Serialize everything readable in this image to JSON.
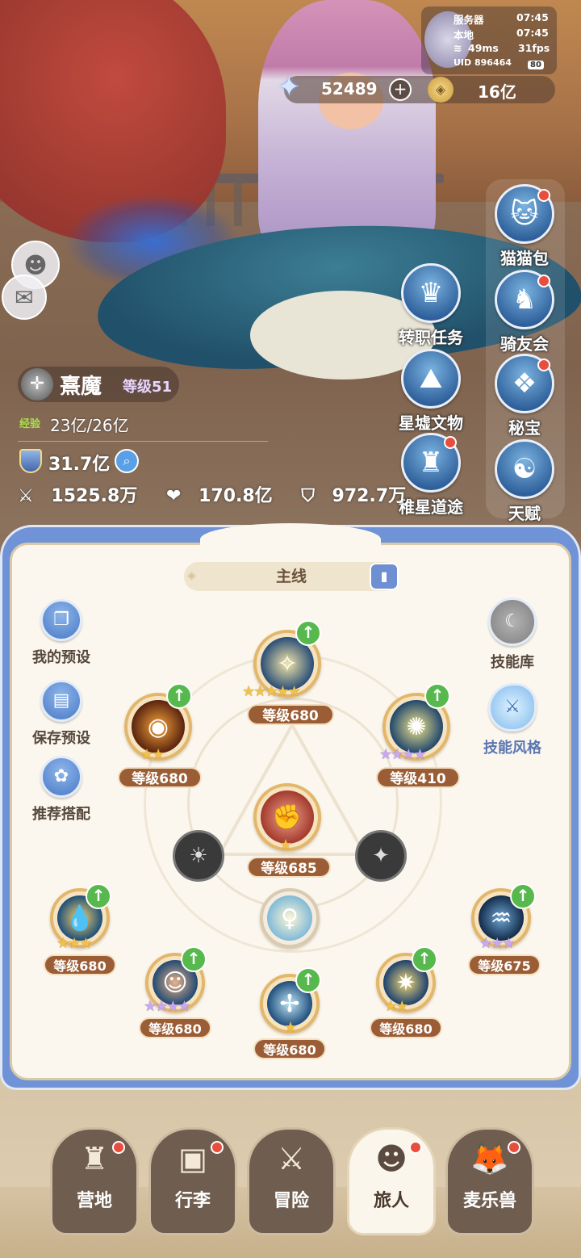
{
  "status": {
    "server_label": "服务器",
    "server_time": "07:45",
    "local_label": "本地",
    "local_time": "07:45",
    "ping": "49ms",
    "fps": "31fps",
    "uid_label": "UID",
    "uid": "896464",
    "battery": "80"
  },
  "currency": {
    "gems": "52489",
    "plus": "+",
    "gold": "16亿"
  },
  "right_menu": [
    {
      "label": "猫猫包",
      "icon": "cat-bag-icon",
      "dot": true
    },
    {
      "label": "骑友会",
      "icon": "horse-icon",
      "dot": true
    },
    {
      "label": "秘宝",
      "icon": "treasure-icon",
      "dot": true
    },
    {
      "label": "天赋",
      "icon": "brain-icon",
      "dot": false
    }
  ],
  "mid_menu": [
    {
      "label": "转职任务",
      "icon": "job-change-icon",
      "dot": false
    },
    {
      "label": "星墟文物",
      "icon": "relic-icon",
      "dot": false
    },
    {
      "label": "稚星道途",
      "icon": "path-icon",
      "dot": true
    }
  ],
  "player": {
    "name": "熹魔",
    "level": "等级51",
    "exp_label": "经验",
    "exp": "23亿/26亿",
    "power": "31.7亿",
    "attack": "1525.8万",
    "hp": "170.8亿",
    "defense": "972.7万"
  },
  "panel": {
    "tab": "主线",
    "left_buttons": [
      "我的预设",
      "保存预设",
      "推荐搭配"
    ],
    "right_buttons": [
      "技能库",
      "技能风格"
    ]
  },
  "skills": [
    {
      "id": "top",
      "level": "等级680",
      "stars": "★★★★★",
      "star_color": "gold",
      "upgrade": true
    },
    {
      "id": "left-top",
      "level": "等级680",
      "stars": "★★",
      "star_color": "gold",
      "upgrade": true
    },
    {
      "id": "right-top",
      "level": "等级410",
      "stars": "★★★★",
      "star_color": "purple",
      "upgrade": true
    },
    {
      "id": "center",
      "level": "等级685",
      "stars": "★",
      "star_color": "gold",
      "upgrade": false
    },
    {
      "id": "far-left",
      "level": "等级680",
      "stars": "★★★",
      "star_color": "gold",
      "upgrade": true
    },
    {
      "id": "far-right",
      "level": "等级675",
      "stars": "★★★",
      "star_color": "purple",
      "upgrade": true
    },
    {
      "id": "low-left",
      "level": "等级680",
      "stars": "★★★★",
      "star_color": "purple",
      "upgrade": true
    },
    {
      "id": "low-mid",
      "level": "等级680",
      "stars": "★",
      "star_color": "gold",
      "upgrade": true
    },
    {
      "id": "low-right",
      "level": "等级680",
      "stars": "★★",
      "star_color": "gold",
      "upgrade": true
    }
  ],
  "bottom_nav": [
    {
      "label": "营地",
      "icon": "castle-icon",
      "dot": true
    },
    {
      "label": "行李",
      "icon": "backpack-icon",
      "dot": true
    },
    {
      "label": "冒险",
      "icon": "crossed-swords-icon",
      "dot": false
    },
    {
      "label": "旅人",
      "icon": "traveler-icon",
      "dot": true,
      "active": true
    },
    {
      "label": "麦乐兽",
      "icon": "fox-icon",
      "dot": true
    }
  ]
}
